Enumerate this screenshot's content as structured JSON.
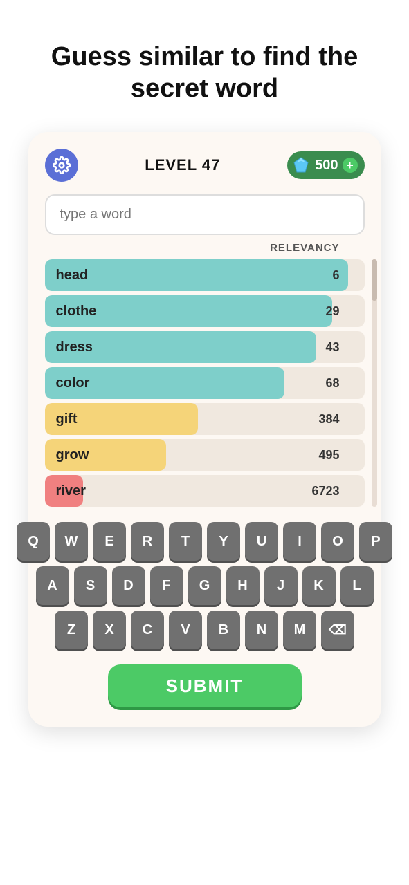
{
  "headline": "Guess similar to find the secret word",
  "card": {
    "level_label": "LEVEL 47",
    "gems_count": "500",
    "input_placeholder": "type a word",
    "relevancy_header": "RELEVANCY",
    "words": [
      {
        "word": "head",
        "score": "6",
        "bar_color": "#7ecfca",
        "bar_pct": 95
      },
      {
        "word": "clothe",
        "score": "29",
        "bar_color": "#7ecfca",
        "bar_pct": 90
      },
      {
        "word": "dress",
        "score": "43",
        "bar_color": "#7ecfca",
        "bar_pct": 85
      },
      {
        "word": "color",
        "score": "68",
        "bar_color": "#7ecfca",
        "bar_pct": 75
      },
      {
        "word": "gift",
        "score": "384",
        "bar_color": "#f5d479",
        "bar_pct": 48
      },
      {
        "word": "grow",
        "score": "495",
        "bar_color": "#f5d479",
        "bar_pct": 38
      },
      {
        "word": "river",
        "score": "6723",
        "bar_color": "#f08080",
        "bar_pct": 12
      }
    ],
    "keyboard": {
      "row1": [
        "Q",
        "W",
        "E",
        "R",
        "T",
        "Y",
        "U",
        "I",
        "O",
        "P"
      ],
      "row2": [
        "A",
        "S",
        "D",
        "F",
        "G",
        "H",
        "J",
        "K",
        "L"
      ],
      "row3": [
        "Z",
        "X",
        "C",
        "V",
        "B",
        "N",
        "M",
        "⌫"
      ]
    },
    "submit_label": "SUBMIT"
  }
}
